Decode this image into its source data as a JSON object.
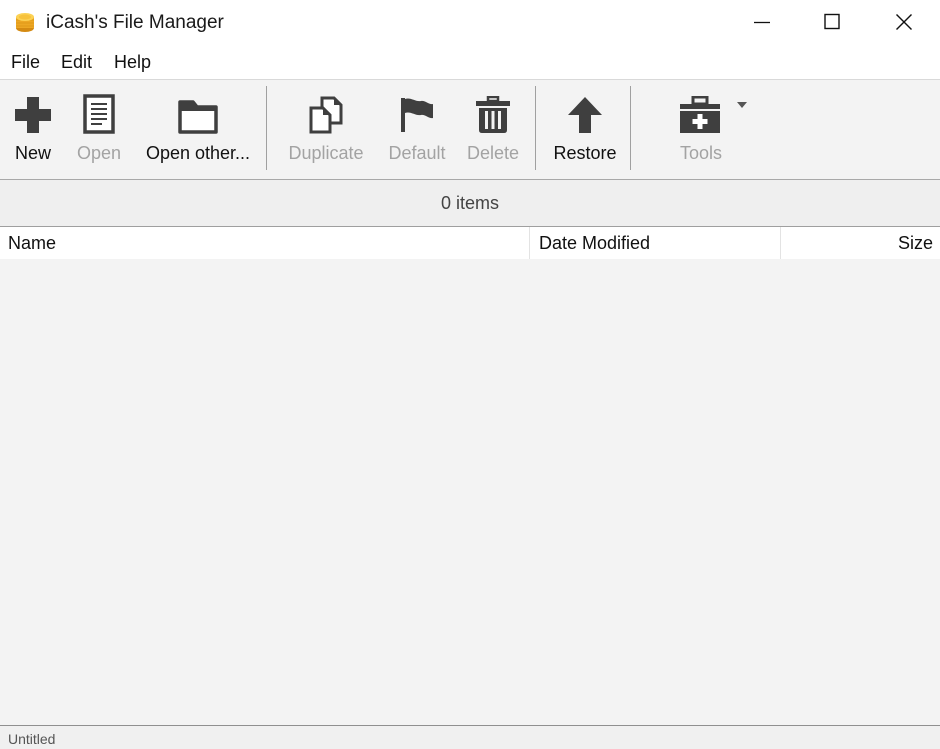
{
  "window": {
    "title": "iCash's File Manager",
    "icon": "coin-stack-icon",
    "controls": {
      "minimize": "minimize",
      "maximize": "maximize",
      "close": "close"
    }
  },
  "menu": {
    "items": [
      {
        "label": "File"
      },
      {
        "label": "Edit"
      },
      {
        "label": "Help"
      }
    ]
  },
  "toolbar": {
    "buttons": [
      {
        "label": "New",
        "icon": "plus-icon",
        "enabled": true
      },
      {
        "label": "Open",
        "icon": "document-icon",
        "enabled": false
      },
      {
        "label": "Open other...",
        "icon": "folder-icon",
        "enabled": true
      },
      {
        "label": "Duplicate",
        "icon": "copy-icon",
        "enabled": false
      },
      {
        "label": "Default",
        "icon": "flag-icon",
        "enabled": false
      },
      {
        "label": "Delete",
        "icon": "trash-icon",
        "enabled": false
      },
      {
        "label": "Restore",
        "icon": "arrow-up-icon",
        "enabled": true
      },
      {
        "label": "Tools",
        "icon": "toolbox-icon",
        "enabled": false,
        "has_dropdown": true
      }
    ]
  },
  "list": {
    "count_text": "0 items",
    "columns": [
      {
        "label": "Name"
      },
      {
        "label": "Date Modified"
      },
      {
        "label": "Size"
      }
    ],
    "rows": []
  },
  "colors": {
    "icon_dark": "#3f3f3f",
    "disabled_text": "#a3a3a3",
    "coin_gold": "#f0b428"
  },
  "status": {
    "text": "Untitled"
  }
}
